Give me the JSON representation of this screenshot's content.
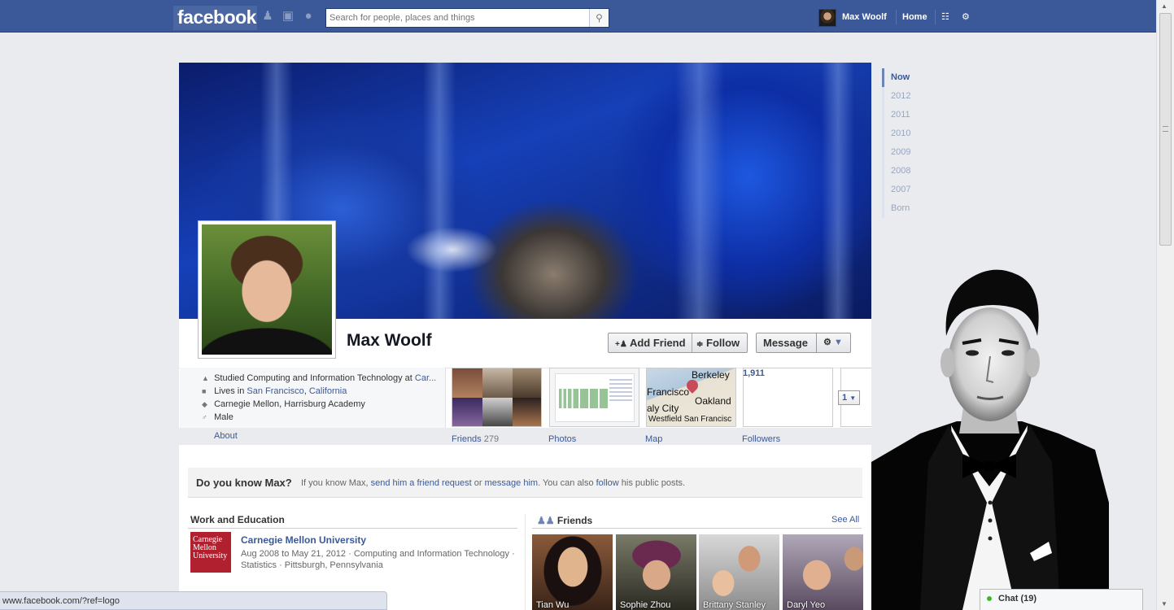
{
  "header": {
    "logo": "facebook",
    "search_placeholder": "Search for people, places and things",
    "user_name": "Max Woolf",
    "home_label": "Home"
  },
  "profile": {
    "name": "Max Woolf",
    "add_friend_label": "Add Friend",
    "follow_label": "Follow",
    "message_label": "Message",
    "info": {
      "studied_prefix": "Studied Computing and Information Technology at ",
      "studied_link": "Car...",
      "lives_prefix": "Lives in ",
      "lives_city": "San Francisco",
      "lives_sep": ", ",
      "lives_state": "California",
      "schools": "Carnegie Mellon, Harrisburg Academy",
      "gender": "Male"
    },
    "about_label": "About",
    "thumbnails": {
      "friends_label": "Friends",
      "friends_count": "279",
      "photos_label": "Photos",
      "map_label": "Map",
      "map_places": [
        "Berkeley",
        "Francisco",
        "Oakland",
        "aly City",
        "Westfield San Francisc"
      ],
      "followers_label": "Followers",
      "followers_count": "1,911",
      "pager_value": "1"
    }
  },
  "know_bar": {
    "title": "Do you know Max?",
    "text_1": "If you know Max, ",
    "link_1": "send him a friend request",
    "text_2": " or ",
    "link_2": "message him",
    "text_3": ". You can also ",
    "link_3": "follow",
    "text_4": " his public posts."
  },
  "work_education": {
    "title": "Work and Education",
    "logo_text": "Carnegie Mellon University",
    "school": "Carnegie Mellon University",
    "description": "Aug 2008 to May 21, 2012 · Computing and Information Technology · Statistics · Pittsburgh, Pennsylvania"
  },
  "friends_section": {
    "title": "Friends",
    "see_all": "See All",
    "friends": [
      "Tian Wu",
      "Sophie Zhou",
      "Brittany Stanley",
      "Daryl Yeo"
    ]
  },
  "timeline_years": [
    "Now",
    "2012",
    "2011",
    "2010",
    "2009",
    "2008",
    "2007",
    "Born"
  ],
  "status_bar": "www.facebook.com/?ref=logo",
  "chat": {
    "label": "Chat",
    "count": "(19)"
  },
  "colors": {
    "brand": "#3b5998",
    "header_border": "#29447e",
    "online": "#42b72a"
  },
  "icons": [
    "friend-requests-icon",
    "messages-icon",
    "notifications-icon",
    "search-icon",
    "privacy-icon",
    "settings-gear-icon"
  ]
}
